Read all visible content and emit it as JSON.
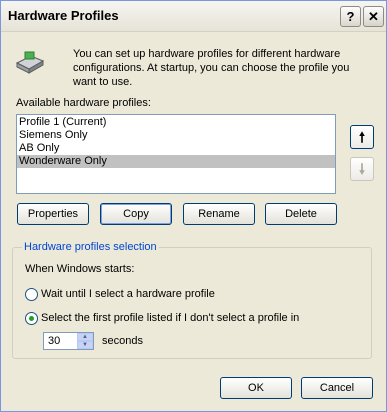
{
  "window": {
    "title": "Hardware Profiles",
    "help": "?",
    "close": "✕"
  },
  "intro": {
    "text": "You can set up hardware profiles for different hardware configurations.  At startup, you can choose the profile you want to use."
  },
  "profiles": {
    "label": "Available hardware profiles:",
    "items": [
      "Profile 1 (Current)",
      "Siemens Only",
      "AB Only",
      "Wonderware Only"
    ],
    "selected_index": 3
  },
  "move": {
    "up": "🠕",
    "down": "🠗"
  },
  "buttons": {
    "properties": "Properties",
    "copy": "Copy",
    "rename": "Rename",
    "delete": "Delete",
    "ok": "OK",
    "cancel": "Cancel"
  },
  "selection": {
    "title": "Hardware profiles selection",
    "when": "When Windows starts:",
    "option_wait": "Wait until I select a hardware profile",
    "option_first": "Select the first profile listed if I don't select a profile in",
    "timeout_value": "30",
    "seconds": "seconds"
  }
}
